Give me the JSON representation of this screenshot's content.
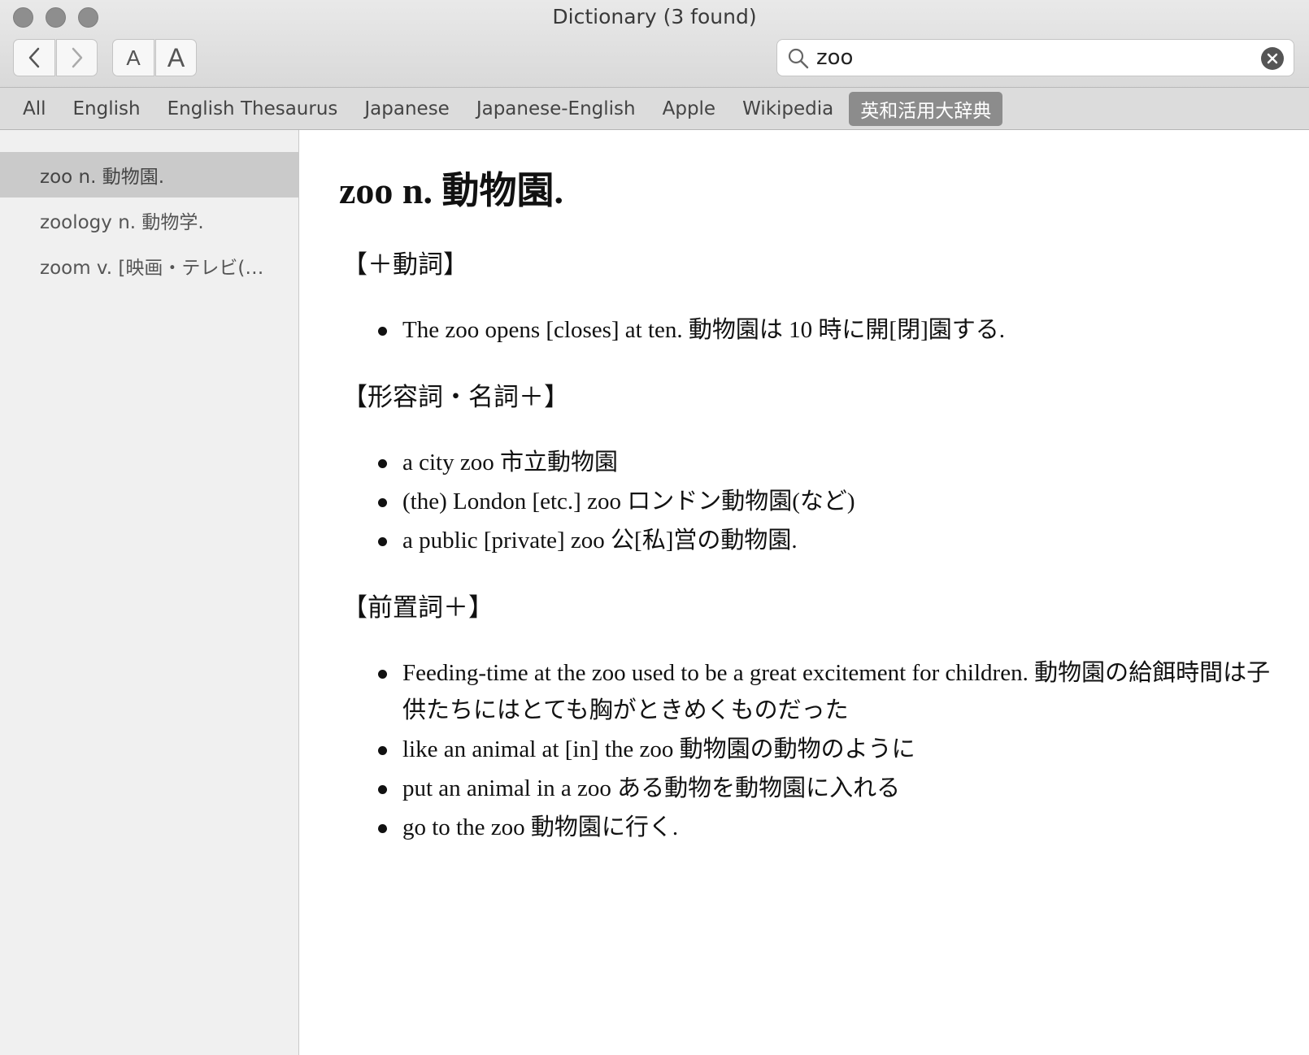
{
  "window": {
    "title": "Dictionary (3 found)"
  },
  "toolbar": {
    "back_icon": "chevron-left-icon",
    "forward_icon": "chevron-right-icon",
    "font_smaller_label": "A",
    "font_larger_label": "A"
  },
  "search": {
    "value": "zoo",
    "icon": "search-icon",
    "clear_icon": "clear-icon"
  },
  "scopes": [
    {
      "label": "All"
    },
    {
      "label": "English"
    },
    {
      "label": "English Thesaurus"
    },
    {
      "label": "Japanese"
    },
    {
      "label": "Japanese-English"
    },
    {
      "label": "Apple"
    },
    {
      "label": "Wikipedia"
    },
    {
      "label": "英和活用大辞典",
      "active": true
    }
  ],
  "results": [
    {
      "label": "zoo n. 動物園.",
      "selected": true
    },
    {
      "label": "zoology n. 動物学."
    },
    {
      "label": "zoom v. [映画・テレビ(…"
    }
  ],
  "entry": {
    "headword": "zoo n. 動物園.",
    "sections": [
      {
        "heading": "【＋動詞】",
        "examples": [
          "The zoo opens [closes] at ten. 動物園は 10 時に開[閉]園する."
        ]
      },
      {
        "heading": "【形容詞・名詞＋】",
        "examples": [
          "a city zoo 市立動物園",
          "(the) London [etc.] zoo ロンドン動物園(など)",
          "a public [private] zoo 公[私]営の動物園."
        ]
      },
      {
        "heading": "【前置詞＋】",
        "examples": [
          "Feeding-time at the zoo used to be a great excitement for children. 動物園の給餌時間は子供たちにはとても胸がときめくものだった",
          "like an animal at [in] the zoo 動物園の動物のように",
          "put an animal in a zoo ある動物を動物園に入れる",
          "go to the zoo 動物園に行く."
        ]
      }
    ]
  }
}
